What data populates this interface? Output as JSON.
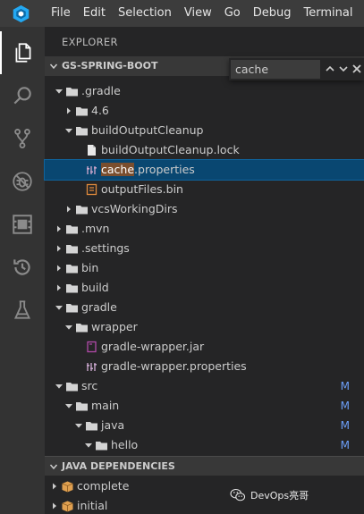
{
  "menu": [
    "File",
    "Edit",
    "Selection",
    "View",
    "Go",
    "Debug",
    "Terminal"
  ],
  "activity": [
    {
      "name": "explorer",
      "icon": "files-icon",
      "active": true
    },
    {
      "name": "search",
      "icon": "search-icon"
    },
    {
      "name": "scm",
      "icon": "source-control-icon"
    },
    {
      "name": "debug",
      "icon": "debug-icon"
    },
    {
      "name": "extensions",
      "icon": "extensions-icon"
    },
    {
      "name": "history",
      "icon": "history-icon"
    },
    {
      "name": "test",
      "icon": "flask-icon"
    }
  ],
  "explorer": {
    "title": "EXPLORER",
    "section": "GS-SPRING-BOOT"
  },
  "find": {
    "value": "cache"
  },
  "tree": [
    {
      "label": ".gradle",
      "depth": 1,
      "twistie": "open",
      "icon": "folder"
    },
    {
      "label": "4.6",
      "depth": 2,
      "twistie": "closed",
      "icon": "folder"
    },
    {
      "label": "buildOutputCleanup",
      "depth": 2,
      "twistie": "open",
      "icon": "folder"
    },
    {
      "label": "buildOutputCleanup.lock",
      "depth": 3,
      "twistie": "none",
      "icon": "file"
    },
    {
      "label_hl": "cache",
      "label_rest": ".properties",
      "depth": 3,
      "twistie": "none",
      "icon": "properties",
      "selected": true
    },
    {
      "label": "outputFiles.bin",
      "depth": 3,
      "twistie": "none",
      "icon": "binary"
    },
    {
      "label": "vcsWorkingDirs",
      "depth": 2,
      "twistie": "closed",
      "icon": "folder"
    },
    {
      "label": ".mvn",
      "depth": 1,
      "twistie": "closed",
      "icon": "folder"
    },
    {
      "label": ".settings",
      "depth": 1,
      "twistie": "closed",
      "icon": "folder"
    },
    {
      "label": "bin",
      "depth": 1,
      "twistie": "closed",
      "icon": "folder"
    },
    {
      "label": "build",
      "depth": 1,
      "twistie": "closed",
      "icon": "folder"
    },
    {
      "label": "gradle",
      "depth": 1,
      "twistie": "open",
      "icon": "folder"
    },
    {
      "label": "wrapper",
      "depth": 2,
      "twistie": "open",
      "icon": "folder"
    },
    {
      "label": "gradle-wrapper.jar",
      "depth": 3,
      "twistie": "none",
      "icon": "jar"
    },
    {
      "label": "gradle-wrapper.properties",
      "depth": 3,
      "twistie": "none",
      "icon": "properties"
    },
    {
      "label": "src",
      "depth": 1,
      "twistie": "open",
      "icon": "folder",
      "badge": "M"
    },
    {
      "label": "main",
      "depth": 2,
      "twistie": "open",
      "icon": "folder",
      "badge": "M"
    },
    {
      "label": "java",
      "depth": 3,
      "twistie": "open",
      "icon": "folder",
      "badge": "M"
    },
    {
      "label": "hello",
      "depth": 4,
      "twistie": "open",
      "icon": "folder",
      "badge": "M"
    }
  ],
  "java_dependencies": {
    "title": "JAVA DEPENDENCIES",
    "items": [
      {
        "label": "complete",
        "twistie": "closed",
        "icon": "package"
      },
      {
        "label": "initial",
        "twistie": "closed",
        "icon": "package"
      }
    ]
  },
  "watermark": {
    "text": "DevOps亮哥",
    "icon": "wechat-icon"
  },
  "colors": {
    "selection": "#094771",
    "highlight": "#7a4e2e",
    "modified_badge": "#6c9ef8",
    "logo": "#23a8f2"
  }
}
